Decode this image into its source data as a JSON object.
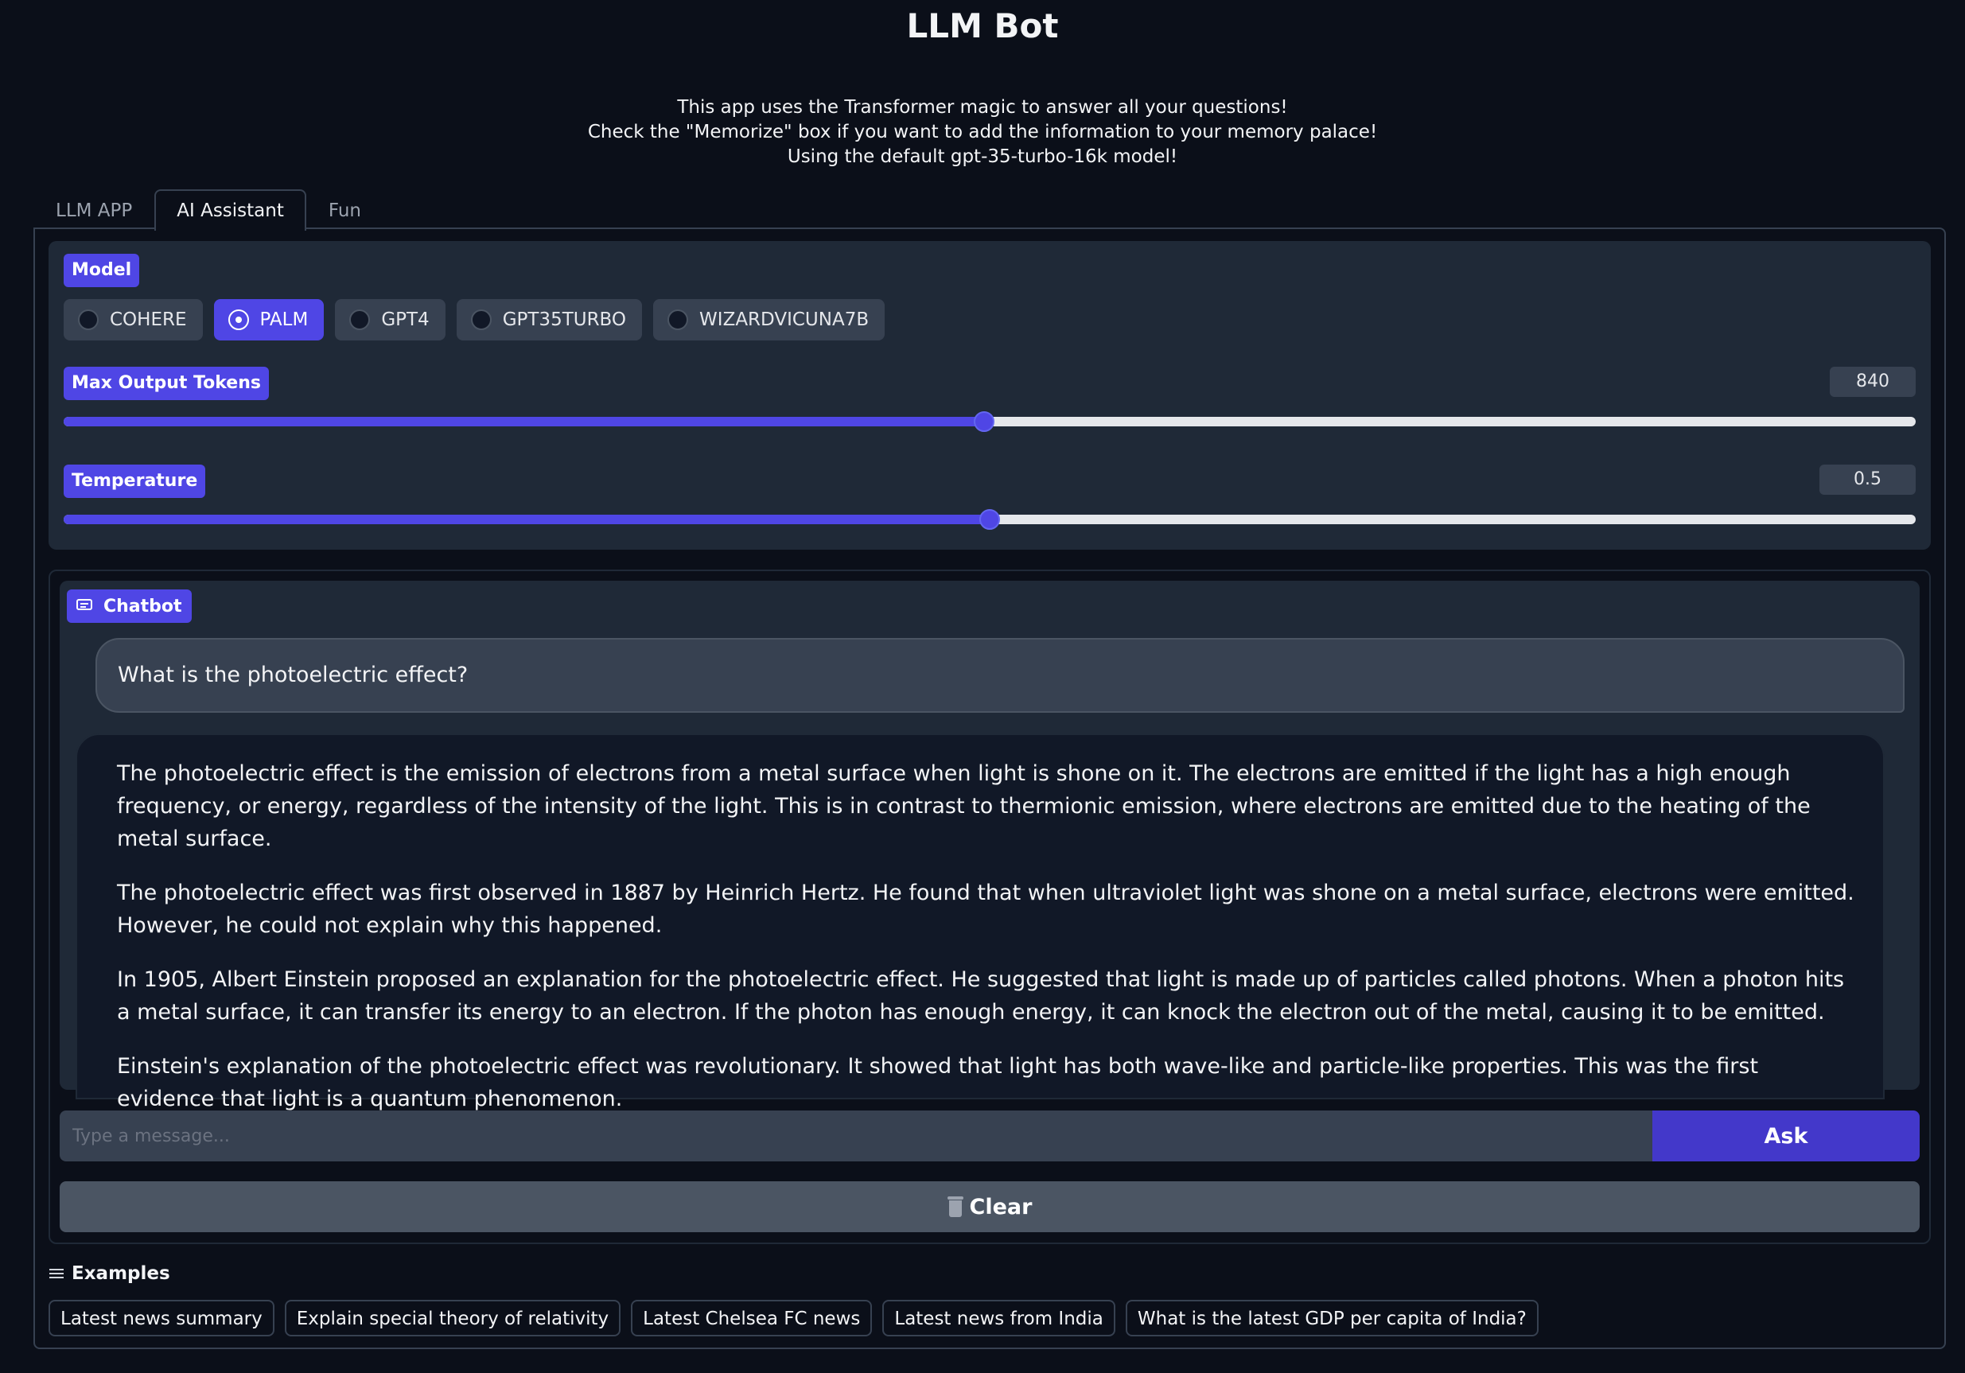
{
  "app": {
    "title": "LLM Bot",
    "description": [
      "This app uses the Transformer magic to answer all your questions!",
      "Check the \"Memorize\" box if you want to add the information to your memory palace!",
      "Using the default gpt-35-turbo-16k model!"
    ]
  },
  "tabs": [
    {
      "label": "LLM APP",
      "active": false
    },
    {
      "label": "AI Assistant",
      "active": true
    },
    {
      "label": "Fun",
      "active": false
    }
  ],
  "model": {
    "label": "Model",
    "options": [
      "COHERE",
      "PALM",
      "GPT4",
      "GPT35TURBO",
      "WIZARDVICUNA7B"
    ],
    "selected": "PALM"
  },
  "max_tokens": {
    "label": "Max Output Tokens",
    "value": "840",
    "fraction": 0.497
  },
  "temperature": {
    "label": "Temperature",
    "value": "0.5",
    "fraction": 0.5
  },
  "chatbot": {
    "label": "Chatbot",
    "user_message": "What is the photoelectric effect?",
    "bot_paragraphs": [
      "The photoelectric effect is the emission of electrons from a metal surface when light is shone on it. The electrons are emitted if the light has a high enough frequency, or energy, regardless of the intensity of the light. This is in contrast to thermionic emission, where electrons are emitted due to the heating of the metal surface.",
      "The photoelectric effect was first observed in 1887 by Heinrich Hertz. He found that when ultraviolet light was shone on a metal surface, electrons were emitted. However, he could not explain why this happened.",
      "In 1905, Albert Einstein proposed an explanation for the photoelectric effect. He suggested that light is made up of particles called photons. When a photon hits a metal surface, it can transfer its energy to an electron. If the photon has enough energy, it can knock the electron out of the metal, causing it to be emitted.",
      "Einstein's explanation of the photoelectric effect was revolutionary. It showed that light has both wave-like and particle-like properties. This was the first evidence that light is a quantum phenomenon."
    ]
  },
  "input": {
    "placeholder": "Type a message...",
    "ask_label": "Ask",
    "clear_label": "Clear"
  },
  "examples": {
    "label": "Examples",
    "items": [
      "Latest news summary",
      "Explain special theory of relativity",
      "Latest Chelsea FC news",
      "Latest news from India",
      "What is the latest GDP per capita of India?"
    ]
  },
  "colors": {
    "background": "#0b0f19",
    "panel": "#1f2937",
    "accent": "#4f46e5",
    "ask_button": "#4338ca",
    "clear_button": "#4b5563"
  }
}
